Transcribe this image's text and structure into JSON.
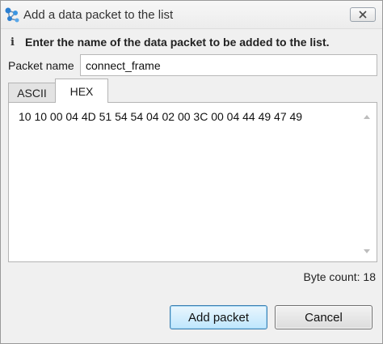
{
  "window": {
    "title": "Add a data packet to the list",
    "icon": "network-nodes-icon",
    "close_icon": "close-icon"
  },
  "info": {
    "icon_glyph": "i",
    "message": "Enter the name of the data packet to be added to the list."
  },
  "packet_name": {
    "label": "Packet name",
    "value": "connect_frame"
  },
  "tabs": [
    {
      "label": "ASCII",
      "selected": false
    },
    {
      "label": "HEX",
      "selected": true
    }
  ],
  "hex_content": "10 10 00 04 4D 51 54 54 04 02 00 3C 00 04 44 49 47 49",
  "byte_count": "Byte count: 18",
  "buttons": {
    "add": "Add packet",
    "cancel": "Cancel"
  },
  "colors": {
    "accent": "#3c7fb1",
    "icon_blue": "#2b7fd1"
  }
}
